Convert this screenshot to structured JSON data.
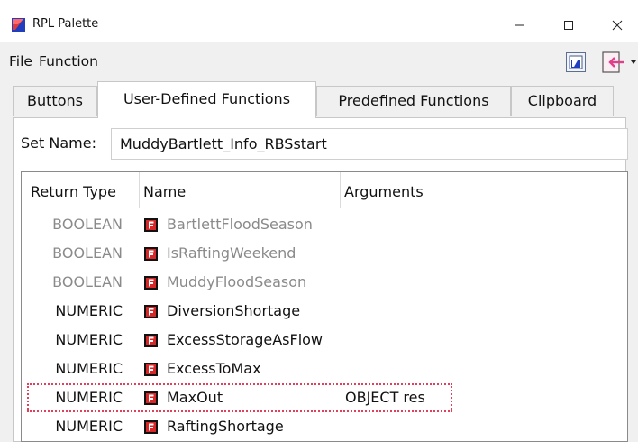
{
  "window": {
    "title": "RPL Palette",
    "controls": {
      "minimize": "minimize-icon",
      "maximize": "maximize-icon",
      "close": "close-icon"
    }
  },
  "menu": {
    "items": [
      "File",
      "Function"
    ]
  },
  "toolbar": {
    "icons": [
      "open-palette-icon",
      "insert-dropdown-icon"
    ]
  },
  "tabs": [
    {
      "label": "Buttons",
      "active": false
    },
    {
      "label": "User-Defined Functions",
      "active": true
    },
    {
      "label": "Predefined Functions",
      "active": false
    },
    {
      "label": "Clipboard",
      "active": false
    }
  ],
  "set": {
    "label": "Set Name:",
    "value": "MuddyBartlett_Info_RBSstart"
  },
  "table": {
    "columns": [
      "Return Type",
      "Name",
      "Arguments"
    ],
    "rows": [
      {
        "type": "BOOLEAN",
        "name": "BartlettFloodSeason",
        "args": "",
        "dim": true
      },
      {
        "type": "BOOLEAN",
        "name": "IsRaftingWeekend",
        "args": "",
        "dim": true
      },
      {
        "type": "BOOLEAN",
        "name": "MuddyFloodSeason",
        "args": "",
        "dim": true
      },
      {
        "type": "NUMERIC",
        "name": "DiversionShortage",
        "args": "",
        "dim": false
      },
      {
        "type": "NUMERIC",
        "name": "ExcessStorageAsFlow",
        "args": "",
        "dim": false
      },
      {
        "type": "NUMERIC",
        "name": "ExcessToMax",
        "args": "",
        "dim": false
      },
      {
        "type": "NUMERIC",
        "name": "MaxOut",
        "args": "OBJECT res",
        "dim": false,
        "selected": true
      },
      {
        "type": "NUMERIC",
        "name": "RaftingShortage",
        "args": "",
        "dim": false
      }
    ]
  },
  "colors": {
    "accent": "#e0405a",
    "brand": "#1f3fbf",
    "dim_text": "#8a8a8a"
  }
}
